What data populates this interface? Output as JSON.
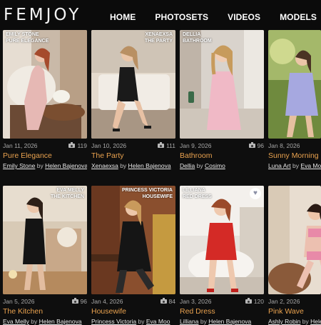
{
  "header": {
    "logo": "FEMJOY",
    "nav": [
      "HOME",
      "PHOTOSETS",
      "VIDEOS",
      "MODELS"
    ]
  },
  "colors": {
    "accent": "#e9a24f",
    "background": "#0e0e0e"
  },
  "cards": [
    {
      "overlay_line1": "EMILY STONE",
      "overlay_line2": "PURE ELEGANCE",
      "overlay_side": "left",
      "date": "Jan 11, 2026",
      "count": "119",
      "title": "Pure Elegance",
      "model": "Emily Stone",
      "by": "by",
      "photographer": "Helen Bajenova"
    },
    {
      "overlay_line1": "XENAEXSA",
      "overlay_line2": "THE PARTY",
      "overlay_side": "right",
      "date": "Jan 10, 2026",
      "count": "111",
      "title": "The Party",
      "model": "Xenaexsa",
      "by": "by",
      "photographer": "Helen Bajenova"
    },
    {
      "overlay_line1": "DELLIA",
      "overlay_line2": "BATHROOM",
      "overlay_side": "left",
      "date": "Jan 9, 2026",
      "count": "96",
      "title": "Bathroom",
      "model": "Dellia",
      "by": "by",
      "photographer": "Cosimo"
    },
    {
      "overlay_line1": "",
      "overlay_line2": "",
      "overlay_side": "left",
      "date": "Jan 8, 2026",
      "count": "",
      "title": "Sunny Morning",
      "model": "Luna Art",
      "by": "by",
      "photographer": "Eva Moo"
    },
    {
      "overlay_line1": "EVA MELLY",
      "overlay_line2": "THE KITCHEN",
      "overlay_side": "right",
      "date": "Jan 5, 2026",
      "count": "96",
      "title": "The Kitchen",
      "model": "Eva Melly",
      "by": "by",
      "photographer": "Helen Bajenova"
    },
    {
      "overlay_line1": "PRINCESS VICTORIA",
      "overlay_line2": "HOUSEWIFE",
      "overlay_side": "right",
      "date": "Jan 4, 2026",
      "count": "84",
      "title": "Housewife",
      "model": "Princess Victoria",
      "by": "by",
      "photographer": "Eva Moo"
    },
    {
      "overlay_line1": "LILLIANA",
      "overlay_line2": "RED DRESS",
      "overlay_side": "left",
      "date": "Jan 3, 2026",
      "count": "120",
      "title": "Red Dress",
      "model": "Lilliana",
      "by": "by",
      "photographer": "Helen Bajenova"
    },
    {
      "overlay_line1": "",
      "overlay_line2": "",
      "overlay_side": "left",
      "date": "Jan 2, 2026",
      "count": "",
      "title": "Pink Wave",
      "model": "Ashly Robin",
      "by": "by",
      "photographer": "Helen"
    }
  ]
}
